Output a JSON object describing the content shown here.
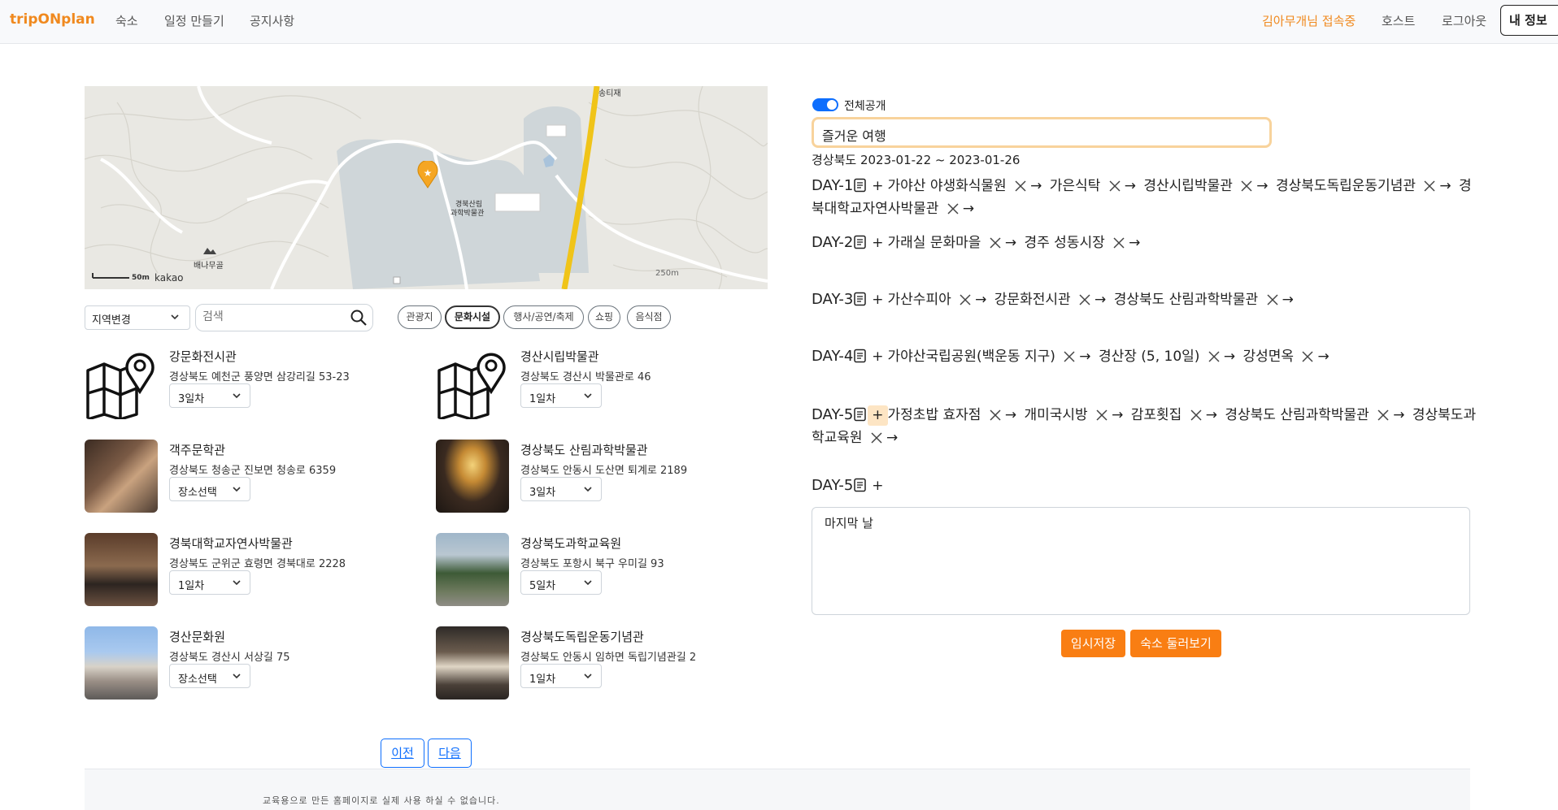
{
  "navbar": {
    "brand": "tripONplan",
    "links": [
      "숙소",
      "일정 만들기",
      "공지사항"
    ],
    "user_status": "김아무개님 접속중",
    "host": "호스트",
    "logout": "로그아웃",
    "my_info": "내 정보"
  },
  "map": {
    "labels": [
      "송티재",
      "경북산림",
      "과학박물관",
      "배나무골",
      "250m",
      "50m",
      "kakao"
    ]
  },
  "filters": {
    "region": "지역변경",
    "search_placeholder": "검색",
    "categories": [
      "관광지",
      "문화시설",
      "행사/공연/축제",
      "쇼핑",
      "음식점"
    ],
    "active_category": "문화시설"
  },
  "places": [
    {
      "name": "강문화전시관",
      "address": "경상북도 예천군 풍양면 삼강리길 53-23",
      "select": "3일차"
    },
    {
      "name": "경산시립박물관",
      "address": "경상북도 경산시 박물관로 46",
      "select": "1일차"
    },
    {
      "name": "객주문학관",
      "address": "경상북도 청송군 진보면 청송로 6359",
      "select": "장소선택"
    },
    {
      "name": "경상북도 산림과학박물관",
      "address": "경상북도 안동시 도산면 퇴계로 2189",
      "select": "3일차"
    },
    {
      "name": "경북대학교자연사박물관",
      "address": "경상북도 군위군 효령면 경북대로 2228",
      "select": "1일차"
    },
    {
      "name": "경상북도과학교육원",
      "address": "경상북도 포항시 북구 우미길 93",
      "select": "5일차"
    },
    {
      "name": "경산문화원",
      "address": "경상북도 경산시 서상길 75",
      "select": "장소선택"
    },
    {
      "name": "경상북도독립운동기념관",
      "address": "경상북도 안동시 임하면 독립기념관길 2",
      "select": "1일차"
    }
  ],
  "pagination": {
    "prev": "이전",
    "next": "다음"
  },
  "footer": "교육용으로 만든 홈페이지로 실제 사용 하실 수 없습니다.",
  "plan": {
    "visibility": "전체공개",
    "title": "즐거운 여행",
    "date_range": "경상북도 2023-01-22 ~ 2023-01-26",
    "days": [
      {
        "label": "DAY-1",
        "places": [
          "가야산 야생화식물원",
          "가은식탁",
          "경산시립박물관",
          "경상북도독립운동기념관",
          "경북대학교자연사박물관"
        ]
      },
      {
        "label": "DAY-2",
        "places": [
          "가래실 문화마을",
          "경주 성동시장"
        ]
      },
      {
        "label": "DAY-3",
        "places": [
          "가산수피아",
          "강문화전시관",
          "경상북도 산림과학박물관"
        ]
      },
      {
        "label": "DAY-4",
        "places": [
          "가야산국립공원(백운동 지구)",
          "경산장 (5, 10일)",
          "강성면옥"
        ]
      },
      {
        "label": "DAY-5",
        "places": [
          "가정초밥 효자점",
          "개미국시방",
          "감포횟집",
          "경상북도 산림과학박물관",
          "경상북도과학교육원"
        ]
      },
      {
        "label": "DAY-5",
        "places": []
      }
    ],
    "memo": "마지막 날",
    "save_draft": "임시저장",
    "browse_lodging": "숙소 둘러보기"
  }
}
